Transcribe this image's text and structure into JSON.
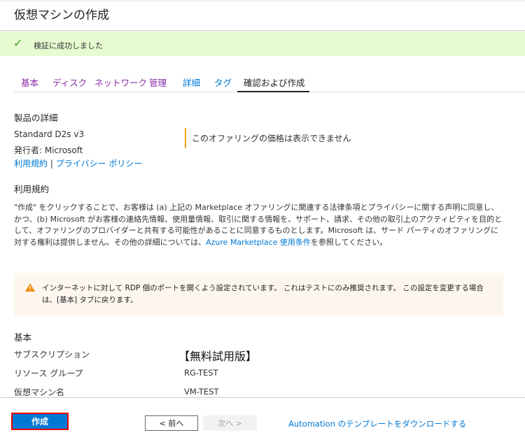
{
  "header": {
    "title": "仮想マシンの作成"
  },
  "banner": {
    "icon": "check-icon",
    "text": "検証に成功しました"
  },
  "tabs": [
    {
      "label": "基本"
    },
    {
      "label": "ディスク"
    },
    {
      "label": "ネットワーク"
    },
    {
      "label": "管理"
    },
    {
      "label": "詳細"
    },
    {
      "label": "タグ"
    },
    {
      "label": "確認および作成"
    }
  ],
  "product": {
    "heading": "製品の詳細",
    "name": "Standard D2s v3",
    "publisher": "発行者: Microsoft",
    "terms_link": "利用規約",
    "separator": "|",
    "privacy_link": "プライバシー ポリシー",
    "price_note": "このオファリングの価格は表示できません"
  },
  "terms": {
    "heading": "利用規約",
    "text_before": "\"作成\" をクリックすることで、お客様は (a) 上記の Marketplace オファリングに関連する法律条項とプライバシーに関する声明に同意し、かつ、(b) Microsoft がお客様の連絡先情報、使用量情報、取引に関する情報を、サポート、請求、その他の取引上のアクティビティを目的として、オファリングのプロバイダーと共有する可能性があることに同意するものとします。Microsoft は、サード パーティのオファリングに対する権利は提供しません。その他の詳細については、",
    "link": "Azure Marketplace 使用条件",
    "text_after": "を参照してください。"
  },
  "warning": {
    "icon": "warning-icon",
    "text": "インターネットに対して RDP 個のポートを開くよう設定されています。 これはテストにのみ推奨されます。 この設定を変更する場合は、[基本] タブに戻ります。"
  },
  "basics": {
    "heading": "基本",
    "rows": [
      {
        "label": "サブスクリプション",
        "value": "【無料試用版】"
      },
      {
        "label": "リソース グループ",
        "value": "RG-TEST"
      },
      {
        "label": "仮想マシン名",
        "value": "VM-TEST"
      }
    ]
  },
  "footer": {
    "create": "作成",
    "prev": "< 前へ",
    "next": "次へ >",
    "automation": "Automation のテンプレートをダウンロードする"
  }
}
